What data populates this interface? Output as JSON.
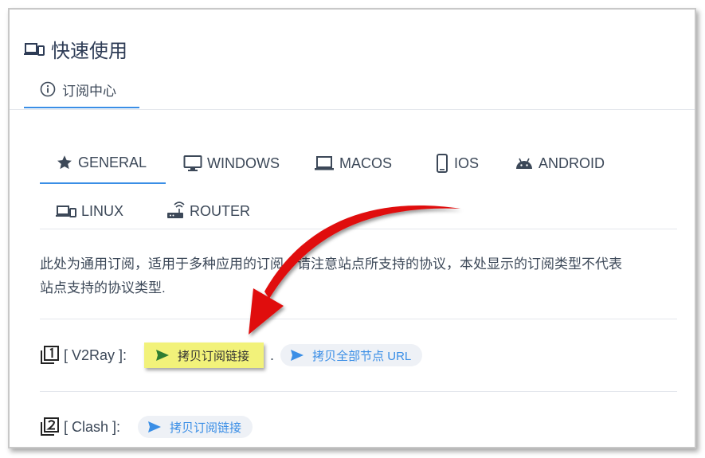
{
  "header": {
    "title": "快速使用",
    "icon": "devices-icon"
  },
  "subtab": {
    "label": "订阅中心",
    "icon": "info-circle-icon"
  },
  "platform_tabs": [
    {
      "label": "GENERAL",
      "icon": "star-icon",
      "active": true
    },
    {
      "label": "WINDOWS",
      "icon": "monitor-icon",
      "active": false
    },
    {
      "label": "MACOS",
      "icon": "laptop-icon",
      "active": false
    },
    {
      "label": "IOS",
      "icon": "phone-icon",
      "active": false
    },
    {
      "label": "ANDROID",
      "icon": "android-icon",
      "active": false
    },
    {
      "label": "LINUX",
      "icon": "devices-icon",
      "active": false
    },
    {
      "label": "ROUTER",
      "icon": "router-icon",
      "active": false
    }
  ],
  "description": {
    "line1": "此处为通用订阅，适用于多种应用的订阅，请注意站点所支持的协议，本处显示的订阅类型不代表",
    "line2": "站点支持的协议类型."
  },
  "rows": [
    {
      "number": "1",
      "label": "[ V2Ray ]:",
      "copy_sub_button": "拷贝订阅链接",
      "separator": ".",
      "copy_all_button": "拷贝全部节点 URL"
    },
    {
      "number": "2",
      "label": "[ Clash ]:",
      "copy_sub_button": "拷贝订阅链接"
    }
  ],
  "colors": {
    "accent": "#3a8ee6",
    "highlight": "#f2f27a",
    "annotation_arrow": "#e01010",
    "text": "#3c4858"
  }
}
